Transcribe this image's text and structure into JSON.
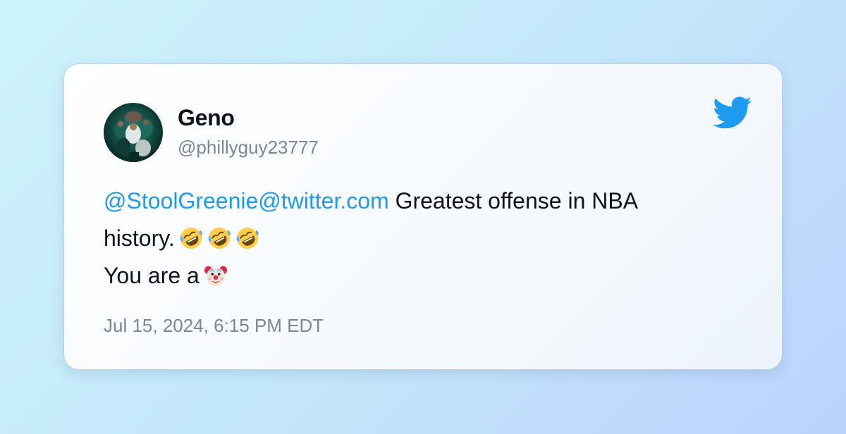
{
  "tweet": {
    "display_name": "Geno",
    "handle": "@phillyguy23777",
    "mention": "@StoolGreenie@twitter.com",
    "line1_text": " Greatest offense in NBA",
    "line2_text": "history.",
    "line3_text": "You are a",
    "timestamp": "Jul 15, 2024, 6:15 PM EDT"
  },
  "icons": {
    "brand": "twitter-bird-icon",
    "emojis": [
      "rolling-on-floor-laughing-emoji",
      "rolling-on-floor-laughing-emoji",
      "rolling-on-floor-laughing-emoji",
      "clown-face-emoji"
    ]
  },
  "colors": {
    "accent": "#1d9bf0",
    "text": "#0f1419",
    "muted": "#7b8791"
  }
}
